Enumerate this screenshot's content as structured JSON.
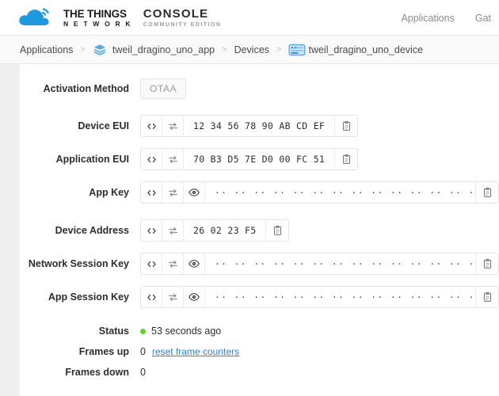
{
  "header": {
    "brand_line1": "THE THINGS",
    "brand_line2": "N E T W O R K",
    "product_line1": "CONSOLE",
    "product_line2": "COMMUNITY EDITION",
    "logo_icon": "cloud-logo-icon",
    "nav": [
      {
        "label": "Applications",
        "name": "nav-applications"
      },
      {
        "label": "Gat",
        "name": "nav-gateways"
      }
    ]
  },
  "breadcrumb": {
    "items": [
      {
        "label": "Applications",
        "icon": null,
        "name": "breadcrumb-applications"
      },
      {
        "label": "tweil_dragino_uno_app",
        "icon": "layers-icon",
        "name": "breadcrumb-application"
      },
      {
        "label": "Devices",
        "icon": null,
        "name": "breadcrumb-devices"
      },
      {
        "label": "tweil_dragino_uno_device",
        "icon": "device-chip-icon",
        "name": "breadcrumb-device"
      }
    ],
    "separator": ">"
  },
  "fields": {
    "activation_method": {
      "label": "Activation Method",
      "value": "OTAA"
    },
    "device_eui": {
      "label": "Device EUI",
      "value": "12 34 56 78 90 AB CD EF",
      "masked": false
    },
    "application_eui": {
      "label": "Application EUI",
      "value": "70 B3 D5 7E D0 00 FC 51",
      "masked": false
    },
    "app_key": {
      "label": "App Key",
      "value": "·· ·· ·· ·· ·· ·· ·· ·· ·· ·· ·· ·· ·· ·· ·· ··",
      "masked": true
    },
    "device_address": {
      "label": "Device Address",
      "value": "26 02 23 F5",
      "masked": false
    },
    "network_session_key": {
      "label": "Network Session Key",
      "value": "·· ·· ·· ·· ·· ·· ·· ·· ·· ·· ·· ·· ·· ·· ·· ··",
      "masked": true
    },
    "app_session_key": {
      "label": "App Session Key",
      "value": "·· ·· ·· ·· ·· ·· ·· ·· ·· ·· ·· ·· ·· ·· ·· ··",
      "masked": true
    }
  },
  "icons": {
    "code_toggle": "code-brackets-icon",
    "format_swap": "swap-arrows-icon",
    "reveal": "eye-icon",
    "copy": "clipboard-copy-icon"
  },
  "status": {
    "label": "Status",
    "value": "53 seconds ago",
    "indicator_color": "#5dd527",
    "frames_up_label": "Frames up",
    "frames_up_value": "0",
    "reset_link": "reset frame counters",
    "frames_down_label": "Frames down",
    "frames_down_value": "0"
  }
}
